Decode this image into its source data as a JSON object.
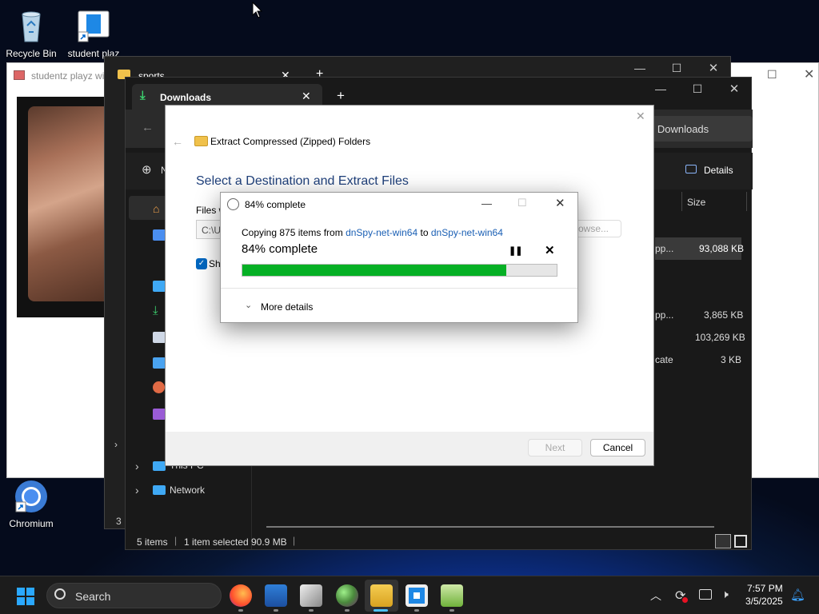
{
  "desktop": {
    "icons": [
      {
        "label": "Recycle Bin"
      },
      {
        "label": "student plaz"
      },
      {
        "label": "Chromium"
      }
    ]
  },
  "windows": {
    "studentz": {
      "title": "studentz playz wi"
    },
    "sports": {
      "tab": "sports",
      "add_tab": "+"
    },
    "downloads": {
      "tab": "Downloads",
      "add_tab": "+",
      "search_placeholder": "h Downloads",
      "new_label": "N",
      "details_label": "Details",
      "size_header": "Size",
      "rows": [
        {
          "type": "pp...",
          "size": "93,088 KB",
          "selected": true
        },
        {
          "type": "pp...",
          "size": "3,865 KB"
        },
        {
          "type": "",
          "size": "103,269 KB"
        },
        {
          "type": "cate",
          "size": "3 KB"
        }
      ],
      "nav_items": [
        {
          "label": "This PC"
        },
        {
          "label": "Network"
        }
      ],
      "status": {
        "items": "5 items",
        "selected": "1 item selected",
        "size": "90.9 MB"
      },
      "sports_status": "3"
    }
  },
  "wizard": {
    "title": "Extract Compressed (Zipped) Folders",
    "heading": "Select a Destination and Extract Files",
    "files_label": "Files w",
    "path_value": "C:\\U",
    "browse_label": "owse...",
    "show_label": "Sho",
    "next_label": "Next",
    "cancel_label": "Cancel"
  },
  "progress": {
    "title": "84% complete",
    "copy_prefix": "Copying 875 items from",
    "source": "dnSpy-net-win64",
    "to_word": "to",
    "dest": "dnSpy-net-win64",
    "status": "84% complete",
    "percent": 84,
    "more_details": "More details"
  },
  "taskbar": {
    "search_label": "Search",
    "time": "7:57 PM",
    "date": "3/5/2025"
  },
  "colors": {
    "progress_fill": "#06b025",
    "link": "#1a5fb4",
    "accent": "#0078d4"
  }
}
